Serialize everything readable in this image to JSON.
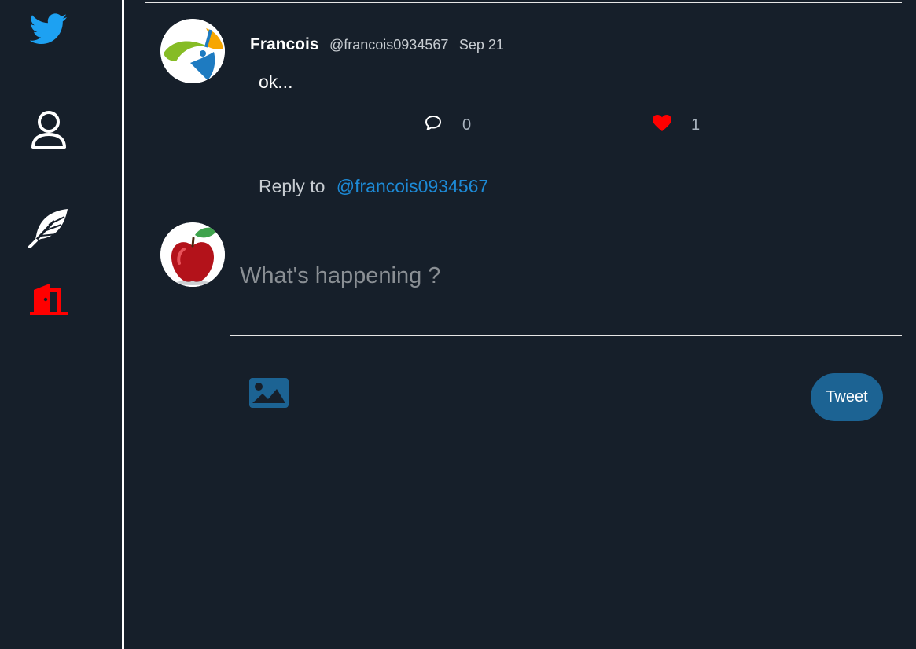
{
  "sidebar": {
    "items": [
      {
        "icon": "twitter-bird-icon",
        "color": "#1da1f2"
      },
      {
        "icon": "user-icon",
        "color": "#ffffff"
      },
      {
        "icon": "feather-icon",
        "color": "#ffffff"
      },
      {
        "icon": "logout-door-icon",
        "color": "#ff0000"
      }
    ]
  },
  "tweet": {
    "author_name": "Francois",
    "author_handle": "@francois0934567",
    "date": "Sep 21",
    "text": "ok...",
    "reply_count": "0",
    "like_count": "1",
    "liked": true
  },
  "reply_to": {
    "label": "Reply to",
    "handle": "@francois0934567"
  },
  "compose": {
    "placeholder": "What's happening ?",
    "value": "",
    "tweet_button_label": "Tweet"
  },
  "colors": {
    "background": "#161f2a",
    "accent": "#1d8ad6",
    "button": "#1c6393",
    "like": "#ff0000"
  }
}
